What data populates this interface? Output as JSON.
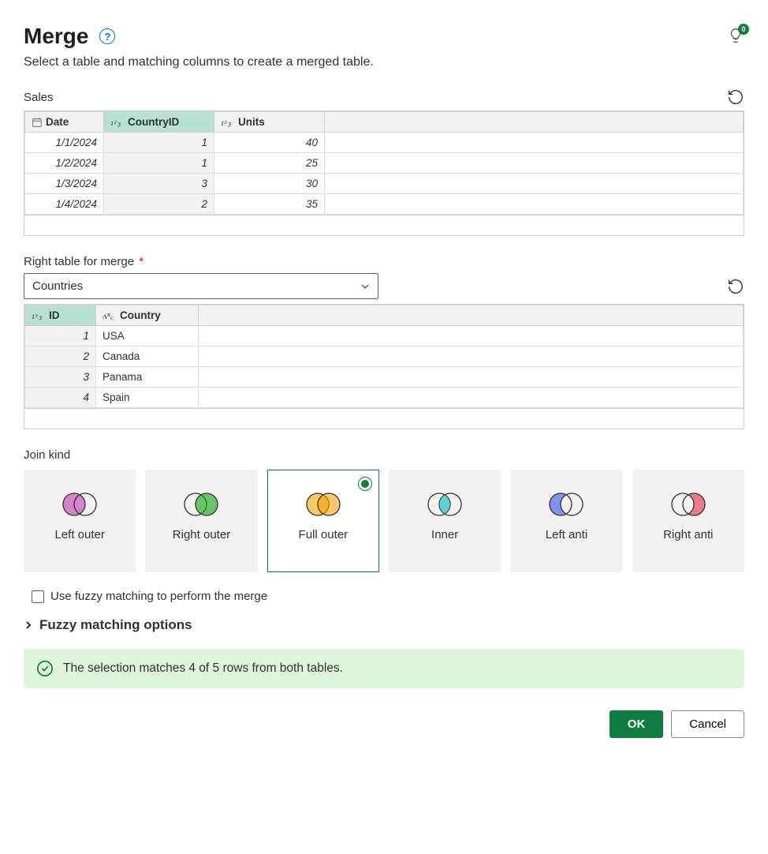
{
  "header": {
    "title": "Merge",
    "subtitle": "Select a table and matching columns to create a merged table.",
    "lightbulb_badge": "0"
  },
  "table1": {
    "label": "Sales",
    "columns": [
      "Date",
      "CountryID",
      "Units"
    ],
    "rows": [
      {
        "date": "1/1/2024",
        "cid": "1",
        "units": "40"
      },
      {
        "date": "1/2/2024",
        "cid": "1",
        "units": "25"
      },
      {
        "date": "1/3/2024",
        "cid": "3",
        "units": "30"
      },
      {
        "date": "1/4/2024",
        "cid": "2",
        "units": "35"
      }
    ]
  },
  "right_table": {
    "label": "Right table for merge",
    "selected": "Countries",
    "columns": [
      "ID",
      "Country"
    ],
    "rows": [
      {
        "id": "1",
        "country": "USA"
      },
      {
        "id": "2",
        "country": "Canada"
      },
      {
        "id": "3",
        "country": "Panama"
      },
      {
        "id": "4",
        "country": "Spain"
      }
    ]
  },
  "join": {
    "label": "Join kind",
    "kinds": [
      "Left outer",
      "Right outer",
      "Full outer",
      "Inner",
      "Left anti",
      "Right anti"
    ],
    "selected_index": 2
  },
  "fuzzy": {
    "checkbox_label": "Use fuzzy matching to perform the merge",
    "options_label": "Fuzzy matching options"
  },
  "status": "The selection matches 4 of 5 rows from both tables.",
  "buttons": {
    "ok": "OK",
    "cancel": "Cancel"
  }
}
